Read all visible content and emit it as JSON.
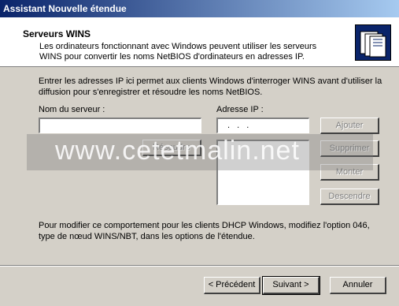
{
  "window": {
    "title": "Assistant Nouvelle étendue"
  },
  "header": {
    "title": "Serveurs WINS",
    "description": "Les ordinateurs fonctionnant avec Windows peuvent utiliser les serveurs WINS pour convertir les noms NetBIOS d'ordinateurs en adresses IP."
  },
  "intro": "Entrer les adresses IP ici permet aux clients Windows d'interroger WINS avant d'utiliser la diffusion pour s'enregistrer et résoudre les noms NetBIOS.",
  "server_name": {
    "label": "Nom du serveur :",
    "value": ""
  },
  "ip": {
    "label": "Adresse IP :",
    "value": "  .   .   ."
  },
  "buttons": {
    "resolve": "Résoudre",
    "add": "Ajouter",
    "remove": "Supprimer",
    "up": "Monter",
    "down": "Descendre",
    "back": "< Précédent",
    "next": "Suivant >",
    "cancel": "Annuler"
  },
  "note": "Pour modifier ce comportement pour les clients DHCP Windows, modifiez l'option 046, type de nœud WINS/NBT, dans les options de l'étendue.",
  "watermark": "www.cetetmalin.net",
  "icon": "folders-icon"
}
